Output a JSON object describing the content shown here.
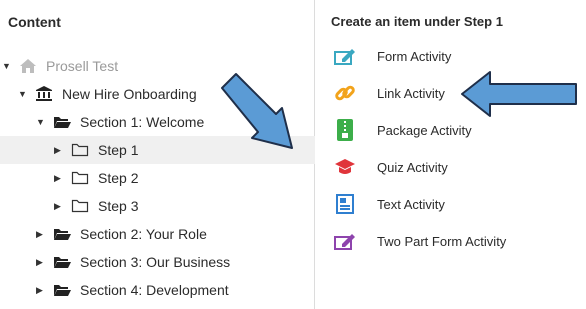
{
  "left_panel": {
    "title": "Content",
    "root": {
      "label": "Prosell Test",
      "icon": "home-icon"
    },
    "course": {
      "label": "New Hire Onboarding",
      "icon": "institution-icon"
    },
    "sections": [
      {
        "label": "Section 1: Welcome",
        "icon": "folder-open-icon",
        "expanded": true
      },
      {
        "label": "Section 2: Your Role",
        "icon": "folder-open-icon",
        "expanded": false
      },
      {
        "label": "Section 3: Our Business",
        "icon": "folder-open-icon",
        "expanded": false
      },
      {
        "label": "Section 4: Development",
        "icon": "folder-open-icon",
        "expanded": false
      }
    ],
    "steps": [
      {
        "label": "Step 1",
        "icon": "folder-outline-icon",
        "selected": true
      },
      {
        "label": "Step 2",
        "icon": "folder-outline-icon",
        "selected": false
      },
      {
        "label": "Step 3",
        "icon": "folder-outline-icon",
        "selected": false
      }
    ],
    "more_menu_icon": "ellipsis-icon"
  },
  "right_panel": {
    "title": "Create an item under Step 1",
    "activities": [
      {
        "label": "Form Activity",
        "icon": "form-edit-icon",
        "color": "#3aa8c1"
      },
      {
        "label": "Link Activity",
        "icon": "link-icon",
        "color": "#f2a31b"
      },
      {
        "label": "Package Activity",
        "icon": "zip-package-icon",
        "color": "#3cae4a"
      },
      {
        "label": "Quiz Activity",
        "icon": "graduation-cap-icon",
        "color": "#e0353b"
      },
      {
        "label": "Text Activity",
        "icon": "document-text-icon",
        "color": "#2f7fd0"
      },
      {
        "label": "Two Part Form Activity",
        "icon": "form-edit-icon",
        "color": "#8e44ad"
      }
    ]
  },
  "colors": {
    "selected_row": "#f0f0f0",
    "arrow_fill": "#5b9bd5",
    "divider": "#dcdcdc"
  }
}
